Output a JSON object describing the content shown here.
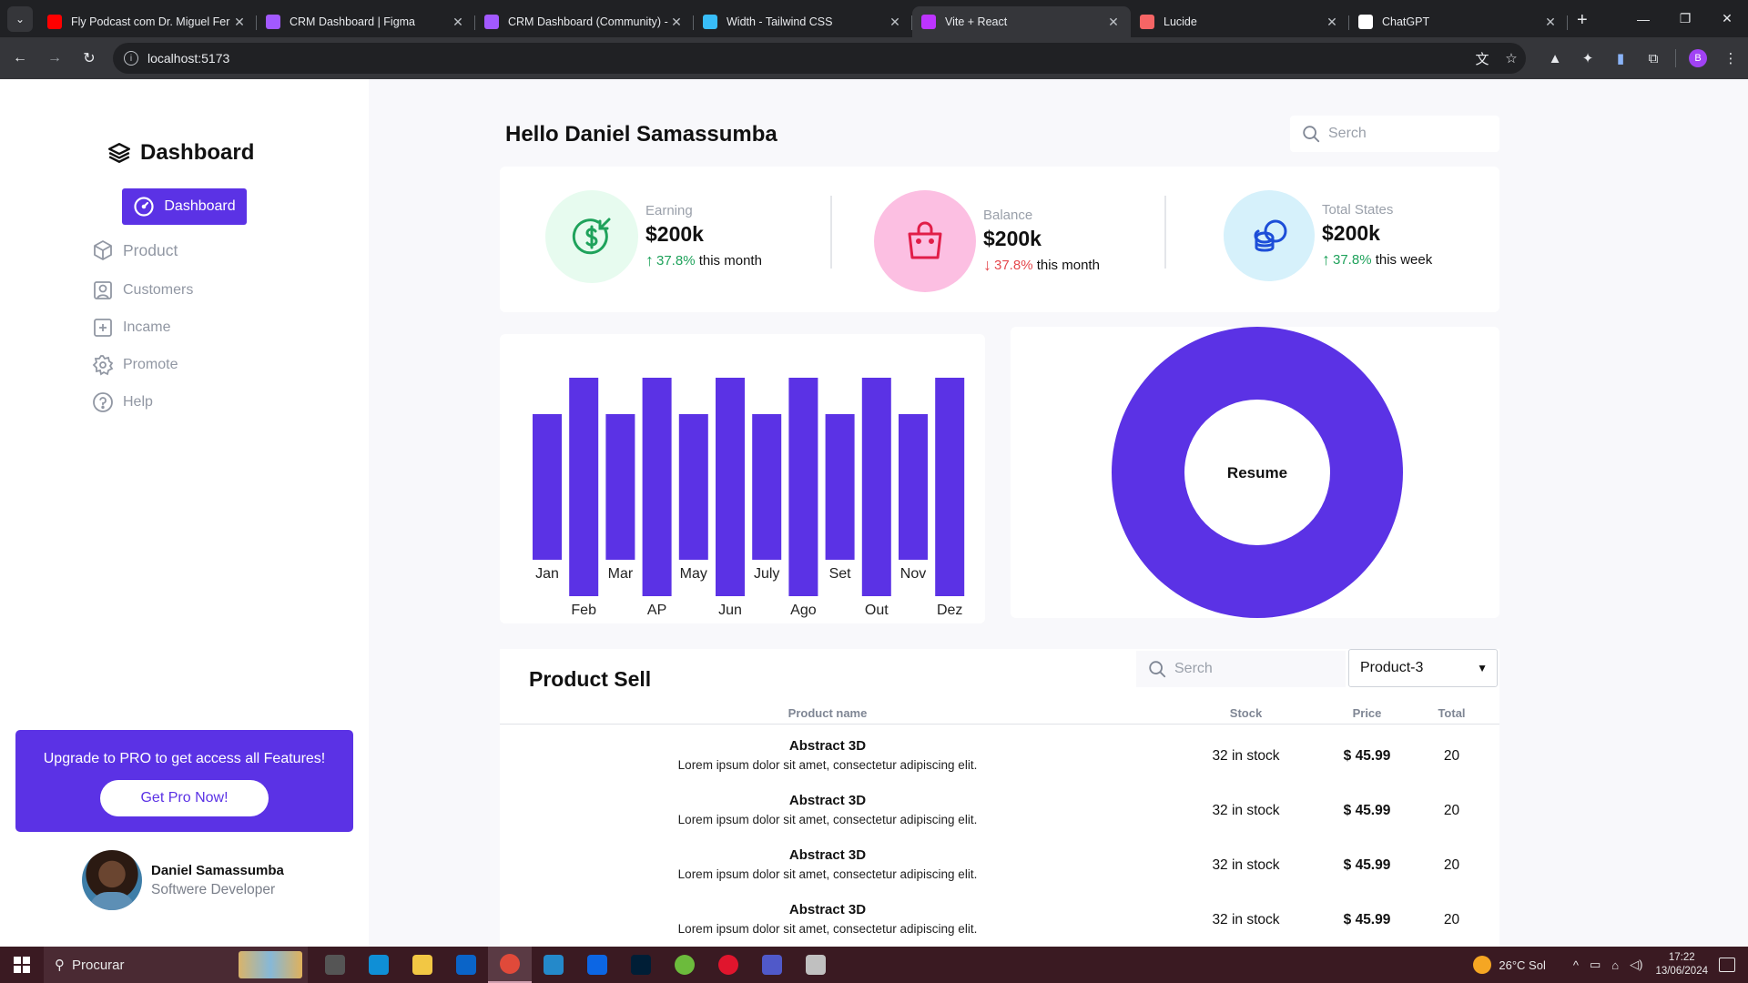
{
  "browser": {
    "tabs": [
      {
        "title": "Fly Podcast com Dr. Miguel Fer",
        "favicon": "youtube-icon",
        "color": "#ff0000",
        "active": false
      },
      {
        "title": "CRM Dashboard | Figma",
        "favicon": "figma-icon",
        "color": "#a259ff",
        "active": false
      },
      {
        "title": "CRM Dashboard (Community) -",
        "favicon": "figma-icon",
        "color": "#a259ff",
        "active": false
      },
      {
        "title": "Width - Tailwind CSS",
        "favicon": "tailwind-icon",
        "color": "#38bdf8",
        "active": false
      },
      {
        "title": "Vite + React",
        "favicon": "vite-icon",
        "color": "#bd34fe",
        "active": true
      },
      {
        "title": "Lucide",
        "favicon": "lucide-icon",
        "color": "#f56565",
        "active": false
      },
      {
        "title": "ChatGPT",
        "favicon": "chatgpt-icon",
        "color": "#ffffff",
        "active": false
      }
    ],
    "url": "localhost:5173",
    "profile_initial": "B"
  },
  "sidebar": {
    "brand": "Dashboard",
    "active_item": "Dashboard",
    "items": [
      {
        "label": "Product",
        "icon": "box-icon"
      },
      {
        "label": "Customers",
        "icon": "user-square-icon"
      },
      {
        "label": "Income",
        "icon": "plus-square-icon"
      },
      {
        "label": "Promote",
        "icon": "gear-icon"
      },
      {
        "label": "Help",
        "icon": "help-circle-icon"
      }
    ],
    "promo": {
      "text": "Upgrade to PRO to get access all Features!",
      "button": "Get Pro Now!"
    },
    "user": {
      "name": "Daniel Samassumba",
      "role": "Softwere Developer"
    }
  },
  "header": {
    "greeting": "Hello Daniel Samassumba",
    "search_placeholder": "Serch"
  },
  "stats": [
    {
      "label": "Earning",
      "value": "$200k",
      "delta": "37.8%",
      "direction": "up",
      "period": "this month",
      "icon": "dollar-icon",
      "bg": "#e7fbef",
      "fg": "#1fa25b"
    },
    {
      "label": "Balance",
      "value": "$200k",
      "delta": "37.8%",
      "direction": "down",
      "period": "this month",
      "icon": "shopping-bag-icon",
      "bg": "#fcbfe2",
      "fg": "#e11d48"
    },
    {
      "label": "Total States",
      "value": "$200k",
      "delta": "37.8%",
      "direction": "up",
      "period": "this week",
      "icon": "coins-icon",
      "bg": "#d6f1fb",
      "fg": "#1d4ed8"
    }
  ],
  "chart_data": [
    {
      "type": "bar",
      "categories": [
        "Jan",
        "Feb",
        "Mar",
        "AP",
        "May",
        "Jun",
        "July",
        "Ago",
        "Set",
        "Out",
        "Nov",
        "Dez"
      ],
      "values": [
        2,
        3,
        2,
        3,
        2,
        3,
        2,
        3,
        2,
        3,
        2,
        3
      ],
      "color": "#5b32e5",
      "grid": false
    },
    {
      "type": "pie",
      "labels": [],
      "values": [
        100
      ],
      "center_label": "Resume",
      "color": "#5b32e5"
    }
  ],
  "product_sell": {
    "title": "Product Sell",
    "search_placeholder": "Serch",
    "select_value": "Product-3",
    "columns": [
      "Product name",
      "Stock",
      "Price",
      "Total"
    ],
    "rows": [
      {
        "name": "Abstract 3D",
        "desc": "Lorem ipsum dolor sit amet, consectetur adipiscing elit.",
        "stock": "32 in stock",
        "price": "$ 45.99",
        "total": "20"
      },
      {
        "name": "Abstract 3D",
        "desc": "Lorem ipsum dolor sit amet, consectetur adipiscing elit.",
        "stock": "32 in stock",
        "price": "$ 45.99",
        "total": "20"
      },
      {
        "name": "Abstract 3D",
        "desc": "Lorem ipsum dolor sit amet, consectetur adipiscing elit.",
        "stock": "32 in stock",
        "price": "$ 45.99",
        "total": "20"
      },
      {
        "name": "Abstract 3D",
        "desc": "Lorem ipsum dolor sit amet, consectetur adipiscing elit.",
        "stock": "32 in stock",
        "price": "$ 45.99",
        "total": "20"
      }
    ]
  },
  "taskbar": {
    "search": "Procurar",
    "weather": "26°C Sol",
    "time": "17:22",
    "date": "13/06/2024",
    "apps": [
      "task-view-icon",
      "edge-icon",
      "file-explorer-icon",
      "outlook-icon",
      "chrome-icon",
      "vscode-icon",
      "trello-icon",
      "photoshop-icon",
      "utorrent-icon",
      "opera-icon",
      "teams-icon",
      "figma-app-icon"
    ]
  }
}
